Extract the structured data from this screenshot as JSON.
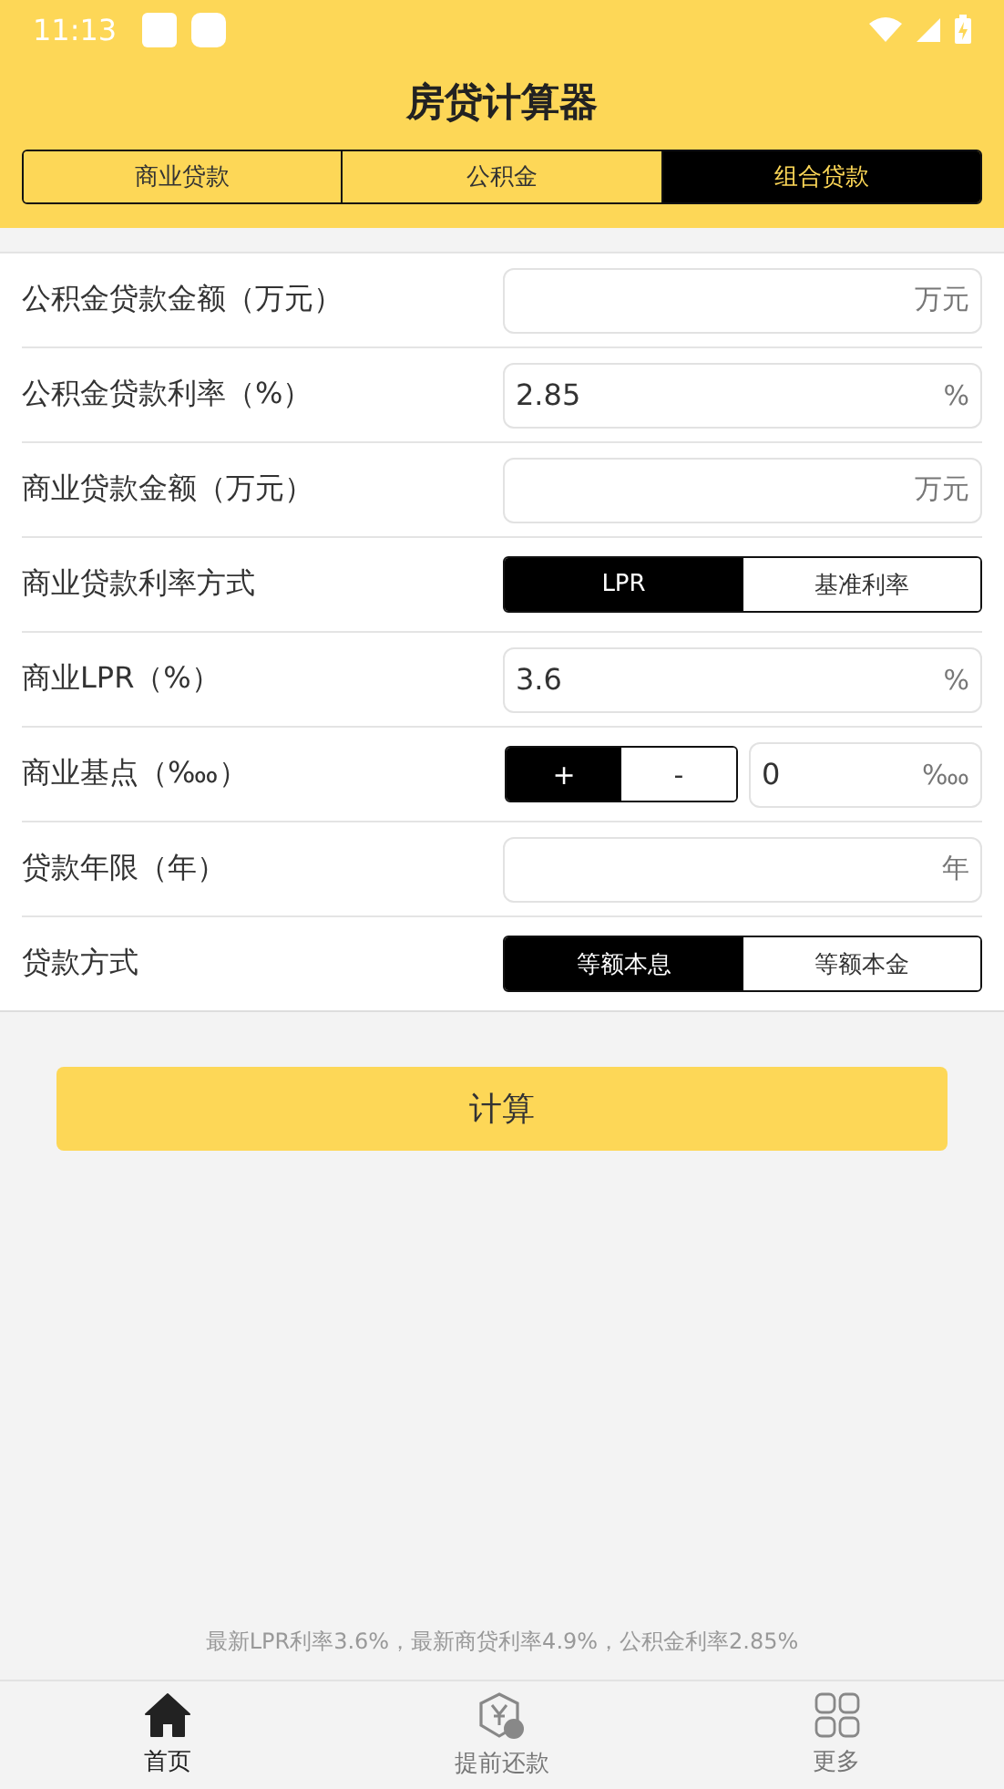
{
  "status_bar": {
    "time": "11:13"
  },
  "title": "房贷计算器",
  "tabs": [
    {
      "label": "商业贷款",
      "selected": false
    },
    {
      "label": "公积金",
      "selected": false
    },
    {
      "label": "组合贷款",
      "selected": true
    }
  ],
  "rows": [
    {
      "kind": "input",
      "label": "公积金贷款金额（万元）",
      "unit": "万元"
    },
    {
      "kind": "input",
      "label": "公积金贷款利率（%）",
      "value": "2.85",
      "unit": "%"
    },
    {
      "kind": "input",
      "label": "商业贷款金额（万元）",
      "unit": "万元"
    },
    {
      "kind": "toggle",
      "label": "商业贷款利率方式",
      "options": [
        {
          "label": "LPR",
          "selected": true
        },
        {
          "label": "基准利率",
          "selected": false
        }
      ]
    },
    {
      "kind": "input",
      "label": "商业LPR（%）",
      "value": "3.6",
      "unit": "%"
    },
    {
      "kind": "sign_input",
      "label": "商业基点（‱）",
      "options": [
        {
          "label": "+",
          "selected": true
        },
        {
          "label": "-",
          "selected": false
        }
      ],
      "value": "0",
      "unit": "‱"
    },
    {
      "kind": "input",
      "label": "贷款年限（年）",
      "unit": "年"
    },
    {
      "kind": "toggle",
      "label": "贷款方式",
      "options": [
        {
          "label": "等额本息",
          "selected": true
        },
        {
          "label": "等额本金",
          "selected": false
        }
      ]
    }
  ],
  "calculate_button": "计算",
  "footer_note": "最新LPR利率3.6%，最新商贷利率4.9%，公积金利率2.85%",
  "nav": [
    {
      "label": "首页",
      "kind": "home",
      "selected": true
    },
    {
      "label": "提前还款",
      "kind": "repay",
      "selected": false
    },
    {
      "label": "更多",
      "kind": "more",
      "selected": false
    }
  ]
}
